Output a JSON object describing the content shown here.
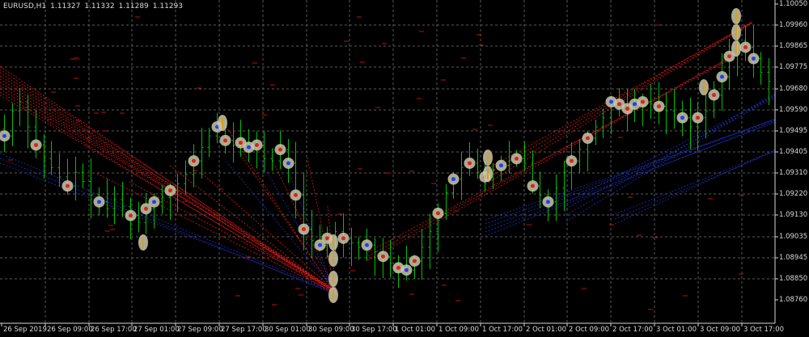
{
  "header": {
    "symbol_timeframe": "EURUSD,H1",
    "ohlc": [
      "1.11327",
      "1.11332",
      "1.11289",
      "1.11293"
    ]
  },
  "price_axis": {
    "labels": [
      "1.10050",
      "1.09960",
      "1.09865",
      "1.09775",
      "1.09680",
      "1.09590",
      "1.09495",
      "1.09405",
      "1.09310",
      "1.09220",
      "1.09130",
      "1.09035",
      "1.08945",
      "1.08850",
      "1.08760"
    ]
  },
  "time_axis": {
    "labels": [
      "26 Sep 2019",
      "26 Sep 09:00",
      "26 Sep 17:00",
      "27 Sep 01:00",
      "27 Sep 09:00",
      "27 Sep 17:00",
      "30 Sep 01:00",
      "30 Sep 09:00",
      "30 Sep 17:00",
      "1 Oct 01:00",
      "1 Oct 09:00",
      "1 Oct 17:00",
      "2 Oct 01:00",
      "2 Oct 09:00",
      "2 Oct 17:00",
      "3 Oct 01:00",
      "3 Oct 09:00",
      "3 Oct 17:00"
    ]
  },
  "colors": {
    "background": "#000000",
    "grid": "#5a5a5a",
    "bars": "#00c000",
    "axis_text": "#d8d8d8",
    "red_lines": "#e01818",
    "blue_lines": "#2030c0",
    "markers": "#c9c7a8"
  },
  "chart_data": {
    "type": "line",
    "series_kind": "ohlc-bars",
    "ylim": [
      1.0876,
      1.1005
    ],
    "grid": true,
    "closes": [
      1.0947,
      1.0958,
      1.0962,
      1.0951,
      1.0943,
      1.0937,
      1.0933,
      1.0929,
      1.0925,
      1.0931,
      1.0927,
      1.0921,
      1.0918,
      1.0915,
      1.0919,
      1.0916,
      1.0912,
      1.0909,
      1.0915,
      1.0918,
      1.092,
      1.0923,
      1.0926,
      1.093,
      1.0936,
      1.0942,
      1.0947,
      1.0951,
      1.0945,
      1.0943,
      1.0944,
      1.0942,
      1.0943,
      1.0937,
      1.0936,
      1.0941,
      1.0935,
      1.0921,
      1.0906,
      1.0901,
      1.0899,
      1.0902,
      1.0905,
      1.0902,
      1.09,
      1.0898,
      1.0899,
      1.0896,
      1.0894,
      1.0891,
      1.0889,
      1.0888,
      1.0892,
      1.0898,
      1.0905,
      1.0913,
      1.0922,
      1.0928,
      1.0933,
      1.0935,
      1.0931,
      1.0929,
      1.0932,
      1.0934,
      1.0936,
      1.0937,
      1.0935,
      1.0925,
      1.0921,
      1.0918,
      1.0924,
      1.0931,
      1.0936,
      1.0941,
      1.0946,
      1.0951,
      1.0955,
      1.0962,
      1.0961,
      1.0959,
      1.0961,
      1.0962,
      1.0961,
      1.096,
      1.0958,
      1.0956,
      1.0955,
      1.0951,
      1.0955,
      1.0958,
      1.0965,
      1.0973,
      1.0982,
      1.0989,
      1.0986,
      1.0981,
      1.0975,
      1.0971
    ]
  }
}
